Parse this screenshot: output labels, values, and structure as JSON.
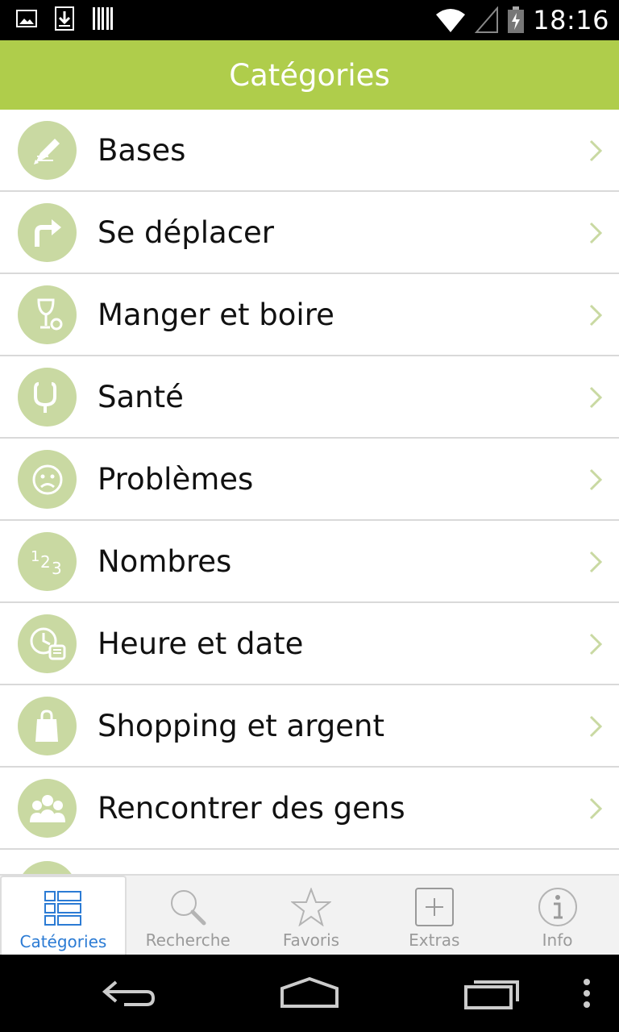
{
  "status_bar": {
    "time": "18:16",
    "left_icons": [
      "image-icon",
      "download-icon",
      "barcode-icon"
    ],
    "right_icons": [
      "wifi-icon",
      "signal-icon",
      "battery-icon"
    ]
  },
  "header": {
    "title": "Catégories"
  },
  "categories": [
    {
      "label": "Bases",
      "icon": "pencil-icon"
    },
    {
      "label": "Se déplacer",
      "icon": "turn-right-arrow-icon"
    },
    {
      "label": "Manger et boire",
      "icon": "glass-icon"
    },
    {
      "label": "Santé",
      "icon": "stethoscope-icon"
    },
    {
      "label": "Problèmes",
      "icon": "sad-face-icon"
    },
    {
      "label": "Nombres",
      "icon": "numbers-icon"
    },
    {
      "label": "Heure et date",
      "icon": "clock-icon"
    },
    {
      "label": "Shopping et argent",
      "icon": "shopping-bag-icon"
    },
    {
      "label": "Rencontrer des gens",
      "icon": "people-icon"
    }
  ],
  "tabs": [
    {
      "label": "Catégories",
      "icon": "list-icon",
      "active": true
    },
    {
      "label": "Recherche",
      "icon": "search-icon",
      "active": false
    },
    {
      "label": "Favoris",
      "icon": "star-icon",
      "active": false
    },
    {
      "label": "Extras",
      "icon": "plus-box-icon",
      "active": false
    },
    {
      "label": "Info",
      "icon": "info-icon",
      "active": false
    }
  ],
  "colors": {
    "accent": "#afcd4b",
    "icon_circle": "#c9d9a2",
    "active_tab": "#2b7bd4",
    "chevron": "#c9d9a2"
  }
}
